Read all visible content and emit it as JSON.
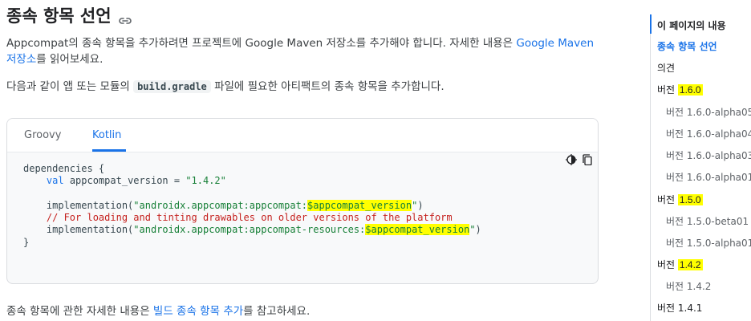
{
  "page": {
    "title": "종속 항목 선언",
    "p1_before": "Appcompat의 종속 항목을 추가하려면 프로젝트에 Google Maven 저장소를 추가해야 합니다. 자세한 내용은 ",
    "p1_link": "Google Maven 저장소",
    "p1_after": "를 읽어보세요.",
    "p2_before": "다음과 같이 앱 또는 모듈의 ",
    "p2_code": "build.gradle",
    "p2_after": " 파일에 필요한 아티팩트의 종속 항목을 추가합니다.",
    "p3_before": "종속 항목에 관한 자세한 내용은 ",
    "p3_link": "빌드 종속 항목 추가",
    "p3_after": "를 참고하세요."
  },
  "code_block": {
    "tabs": [
      "Groovy",
      "Kotlin"
    ],
    "active_tab": "Kotlin",
    "line1": "dependencies {",
    "line2_kw": "val",
    "line2_rest": " appcompat_version = ",
    "line2_str": "\"1.4.2\"",
    "line4_pre": "implementation(",
    "line4_str_a": "\"androidx.appcompat:appcompat:",
    "line4_str_hl": "$appcompat_version",
    "line4_str_b": "\"",
    "line4_post": ")",
    "line5_comment": "// For loading and tinting drawables on older versions of the platform",
    "line6_pre": "implementation(",
    "line6_str_a": "\"androidx.appcompat:appcompat-resources:",
    "line6_str_hl": "$appcompat_version",
    "line6_str_b": "\"",
    "line6_post": ")",
    "line7": "}"
  },
  "toc": {
    "heading": "이 페이지의 내용",
    "items": [
      {
        "label": "종속 항목 선언",
        "sub": false,
        "active": true
      },
      {
        "label": "의견",
        "sub": false
      },
      {
        "prefix": "버전 ",
        "version": "1.6.0",
        "sub": false,
        "highlight": true
      },
      {
        "label": "버전 1.6.0-alpha05",
        "sub": true
      },
      {
        "label": "버전 1.6.0-alpha04",
        "sub": true
      },
      {
        "label": "버전 1.6.0-alpha03",
        "sub": true
      },
      {
        "label": "버전 1.6.0-alpha01",
        "sub": true
      },
      {
        "prefix": "버전 ",
        "version": "1.5.0",
        "sub": false,
        "highlight": true
      },
      {
        "label": "버전 1.5.0-beta01",
        "sub": true
      },
      {
        "label": "버전 1.5.0-alpha01",
        "sub": true
      },
      {
        "prefix": "버전 ",
        "version": "1.4.2",
        "sub": false,
        "highlight": true
      },
      {
        "label": "버전 1.4.2",
        "sub": true
      },
      {
        "label": "버전 1.4.1",
        "sub": false
      }
    ]
  },
  "colors": {
    "accent": "#1a73e8",
    "highlight": "#ffff00",
    "string": "#188038",
    "comment": "#c5221f"
  },
  "icons": {
    "title_link": "link-icon",
    "theme_toggle": "dark-mode-icon",
    "copy": "copy-icon"
  }
}
